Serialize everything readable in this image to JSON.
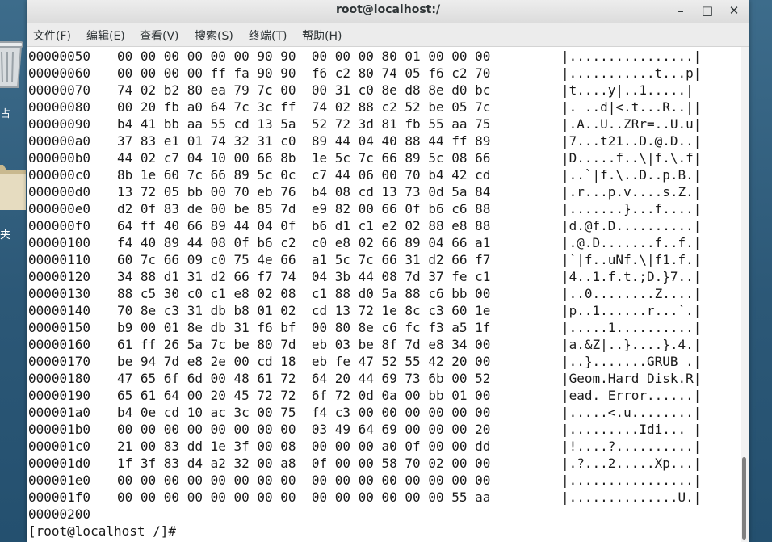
{
  "window": {
    "title": "root@localhost:/",
    "min": "–",
    "max": "□",
    "close": "✕"
  },
  "desktop": {
    "label1": "占",
    "label2": "夹"
  },
  "menu": [
    "文件(F)",
    "编辑(E)",
    "查看(V)",
    "搜索(S)",
    "终端(T)",
    "帮助(H)"
  ],
  "hexdump": [
    {
      "offset": "00000050",
      "hex": "00 00 00 00 00 00 90 90  00 00 00 80 01 00 00 00",
      "ascii": "|................|"
    },
    {
      "offset": "00000060",
      "hex": "00 00 00 00 ff fa 90 90  f6 c2 80 74 05 f6 c2 70",
      "ascii": "|...........t...p|"
    },
    {
      "offset": "00000070",
      "hex": "74 02 b2 80 ea 79 7c 00  00 31 c0 8e d8 8e d0 bc",
      "ascii": "|t....y|..1.....|"
    },
    {
      "offset": "00000080",
      "hex": "00 20 fb a0 64 7c 3c ff  74 02 88 c2 52 be 05 7c",
      "ascii": "|. ..d|<.t...R..||"
    },
    {
      "offset": "00000090",
      "hex": "b4 41 bb aa 55 cd 13 5a  52 72 3d 81 fb 55 aa 75",
      "ascii": "|.A..U..ZRr=..U.u|"
    },
    {
      "offset": "000000a0",
      "hex": "37 83 e1 01 74 32 31 c0  89 44 04 40 88 44 ff 89",
      "ascii": "|7...t21..D.@.D..|"
    },
    {
      "offset": "000000b0",
      "hex": "44 02 c7 04 10 00 66 8b  1e 5c 7c 66 89 5c 08 66",
      "ascii": "|D.....f..\\|f.\\.f|"
    },
    {
      "offset": "000000c0",
      "hex": "8b 1e 60 7c 66 89 5c 0c  c7 44 06 00 70 b4 42 cd",
      "ascii": "|..`|f.\\..D..p.B.|"
    },
    {
      "offset": "000000d0",
      "hex": "13 72 05 bb 00 70 eb 76  b4 08 cd 13 73 0d 5a 84",
      "ascii": "|.r...p.v....s.Z.|"
    },
    {
      "offset": "000000e0",
      "hex": "d2 0f 83 de 00 be 85 7d  e9 82 00 66 0f b6 c6 88",
      "ascii": "|.......}...f....|"
    },
    {
      "offset": "000000f0",
      "hex": "64 ff 40 66 89 44 04 0f  b6 d1 c1 e2 02 88 e8 88",
      "ascii": "|d.@f.D..........|"
    },
    {
      "offset": "00000100",
      "hex": "f4 40 89 44 08 0f b6 c2  c0 e8 02 66 89 04 66 a1",
      "ascii": "|.@.D.......f..f.|"
    },
    {
      "offset": "00000110",
      "hex": "60 7c 66 09 c0 75 4e 66  a1 5c 7c 66 31 d2 66 f7",
      "ascii": "|`|f..uNf.\\|f1.f.|"
    },
    {
      "offset": "00000120",
      "hex": "34 88 d1 31 d2 66 f7 74  04 3b 44 08 7d 37 fe c1",
      "ascii": "|4..1.f.t.;D.}7..|"
    },
    {
      "offset": "00000130",
      "hex": "88 c5 30 c0 c1 e8 02 08  c1 88 d0 5a 88 c6 bb 00",
      "ascii": "|..0........Z....|"
    },
    {
      "offset": "00000140",
      "hex": "70 8e c3 31 db b8 01 02  cd 13 72 1e 8c c3 60 1e",
      "ascii": "|p..1......r...`.|"
    },
    {
      "offset": "00000150",
      "hex": "b9 00 01 8e db 31 f6 bf  00 80 8e c6 fc f3 a5 1f",
      "ascii": "|.....1..........|"
    },
    {
      "offset": "00000160",
      "hex": "61 ff 26 5a 7c be 80 7d  eb 03 be 8f 7d e8 34 00",
      "ascii": "|a.&Z|..}....}.4.|"
    },
    {
      "offset": "00000170",
      "hex": "be 94 7d e8 2e 00 cd 18  eb fe 47 52 55 42 20 00",
      "ascii": "|..}.......GRUB .|"
    },
    {
      "offset": "00000180",
      "hex": "47 65 6f 6d 00 48 61 72  64 20 44 69 73 6b 00 52",
      "ascii": "|Geom.Hard Disk.R|"
    },
    {
      "offset": "00000190",
      "hex": "65 61 64 00 20 45 72 72  6f 72 0d 0a 00 bb 01 00",
      "ascii": "|ead. Error......|"
    },
    {
      "offset": "000001a0",
      "hex": "b4 0e cd 10 ac 3c 00 75  f4 c3 00 00 00 00 00 00",
      "ascii": "|.....<.u........|"
    },
    {
      "offset": "000001b0",
      "hex": "00 00 00 00 00 00 00 00  03 49 64 69 00 00 00 20",
      "ascii": "|.........Idi... |"
    },
    {
      "offset": "000001c0",
      "hex": "21 00 83 dd 1e 3f 00 08  00 00 00 a0 0f 00 00 dd",
      "ascii": "|!....?..........|"
    },
    {
      "offset": "000001d0",
      "hex": "1f 3f 83 d4 a2 32 00 a8  0f 00 00 58 70 02 00 00",
      "ascii": "|.?...2.....Xp...|"
    },
    {
      "offset": "000001e0",
      "hex": "00 00 00 00 00 00 00 00  00 00 00 00 00 00 00 00",
      "ascii": "|................|"
    },
    {
      "offset": "000001f0",
      "hex": "00 00 00 00 00 00 00 00  00 00 00 00 00 00 55 aa",
      "ascii": "|..............U.|"
    }
  ],
  "end_offset": "00000200",
  "prompt": "[root@localhost /]# "
}
